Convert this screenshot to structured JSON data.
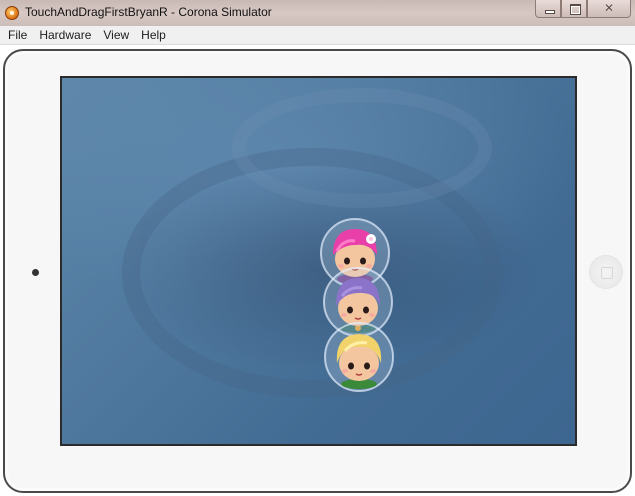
{
  "window": {
    "title": "TouchAndDragFirstBryanR - Corona Simulator",
    "close_glyph": "✕"
  },
  "menu": {
    "items": [
      "File",
      "Hardware",
      "View",
      "Help"
    ]
  },
  "device": {
    "model": "tablet",
    "orientation": "landscape"
  },
  "scene": {
    "characters": [
      {
        "name": "pink-hair-girl",
        "hair_color": "#e83fa8"
      },
      {
        "name": "purple-hair-girl",
        "hair_color": "#8a73c8"
      },
      {
        "name": "blonde-hair-girl",
        "hair_color": "#f2d36b"
      }
    ]
  },
  "colors": {
    "screen_bg": "#4f789e",
    "titlebar": "#d4c4c0"
  }
}
